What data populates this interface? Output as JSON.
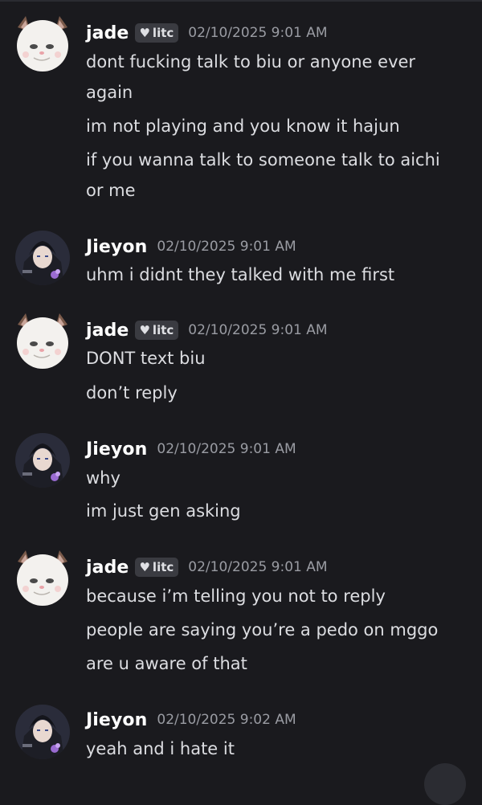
{
  "messages": [
    {
      "author": "jade",
      "avatar_icon": "white-cat-avatar-icon",
      "tag": "litc",
      "tag_icon": "heart-icon",
      "timestamp": "02/10/2025 9:01 AM",
      "lines": [
        "dont fucking talk to biu or anyone ever",
        "again",
        "im not playing and you know it hajun",
        "if you wanna talk to someone talk to aichi",
        "or me"
      ]
    },
    {
      "author": "Jieyon",
      "avatar_icon": "anime-character-avatar-icon",
      "timestamp": "02/10/2025 9:01 AM",
      "lines": [
        "uhm i didnt they talked with me first"
      ]
    },
    {
      "author": "jade",
      "avatar_icon": "white-cat-avatar-icon",
      "tag": "litc",
      "tag_icon": "heart-icon",
      "timestamp": "02/10/2025 9:01 AM",
      "lines": [
        "DONT text biu",
        "don’t reply"
      ]
    },
    {
      "author": "Jieyon",
      "avatar_icon": "anime-character-avatar-icon",
      "timestamp": "02/10/2025 9:01 AM",
      "lines": [
        "why",
        "im just gen asking"
      ]
    },
    {
      "author": "jade",
      "avatar_icon": "white-cat-avatar-icon",
      "tag": "litc",
      "tag_icon": "heart-icon",
      "timestamp": "02/10/2025 9:01 AM",
      "lines": [
        "because i’m telling you not to reply",
        "people are saying you’re a pedo on mggo",
        "are u aware of that"
      ]
    },
    {
      "author": "Jieyon",
      "avatar_icon": "anime-character-avatar-icon",
      "timestamp": "02/10/2025 9:02 AM",
      "lines": [
        "yeah and i hate it"
      ]
    }
  ],
  "colors": {
    "background": "#1a1a1e",
    "username": "#ffffff",
    "message_text": "#dcdde1",
    "timestamp": "#9a9ca3",
    "tag_background": "#3a3b41"
  }
}
